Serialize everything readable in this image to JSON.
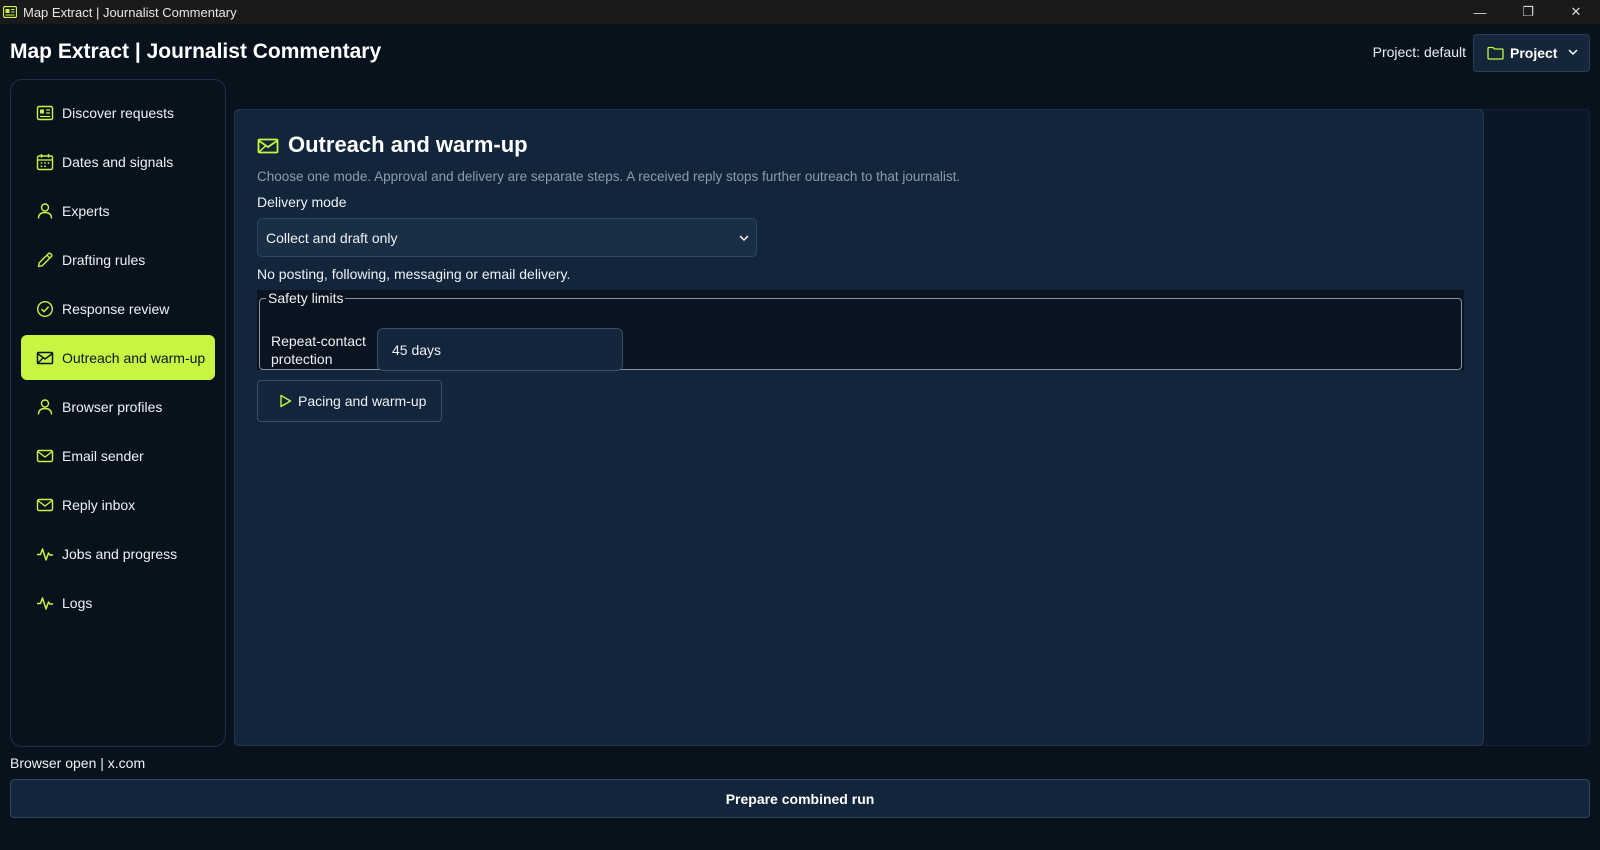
{
  "window": {
    "title": "Map Extract | Journalist Commentary",
    "minimize_glyph": "—",
    "restore_glyph": "❐",
    "close_glyph": "✕"
  },
  "header": {
    "app_title": "Map Extract | Journalist Commentary",
    "project_label": "Project: default",
    "project_button": "Project"
  },
  "sidebar": {
    "items": [
      {
        "label": "Discover requests",
        "icon": "newspaper-icon"
      },
      {
        "label": "Dates and signals",
        "icon": "calendar-icon"
      },
      {
        "label": "Experts",
        "icon": "user-icon"
      },
      {
        "label": "Drafting rules",
        "icon": "pencil-icon"
      },
      {
        "label": "Response review",
        "icon": "check-circle-icon"
      },
      {
        "label": "Outreach and warm-up",
        "icon": "mail-open-icon",
        "active": true
      },
      {
        "label": "Browser profiles",
        "icon": "user-icon"
      },
      {
        "label": "Email sender",
        "icon": "mail-icon"
      },
      {
        "label": "Reply inbox",
        "icon": "mail-icon"
      },
      {
        "label": "Jobs and progress",
        "icon": "activity-icon"
      },
      {
        "label": "Logs",
        "icon": "activity-icon"
      }
    ]
  },
  "main": {
    "section_title": "Outreach and warm-up",
    "description": "Choose one mode. Approval and delivery are separate steps. A received reply stops further outreach to that journalist.",
    "delivery_mode_label": "Delivery mode",
    "delivery_mode_value": "Collect and draft only",
    "delivery_mode_note": "No posting, following, messaging or email delivery.",
    "safety_limits": {
      "legend": "Safety limits",
      "repeat_contact_label": "Repeat-contact protection",
      "repeat_contact_value": "45 days"
    },
    "pacing_button": "Pacing and warm-up"
  },
  "footer": {
    "status": "Browser open | x.com",
    "run_button": "Prepare combined run"
  },
  "colors": {
    "accent": "#c6f542",
    "background": "#08121c",
    "card": "#13253b"
  }
}
